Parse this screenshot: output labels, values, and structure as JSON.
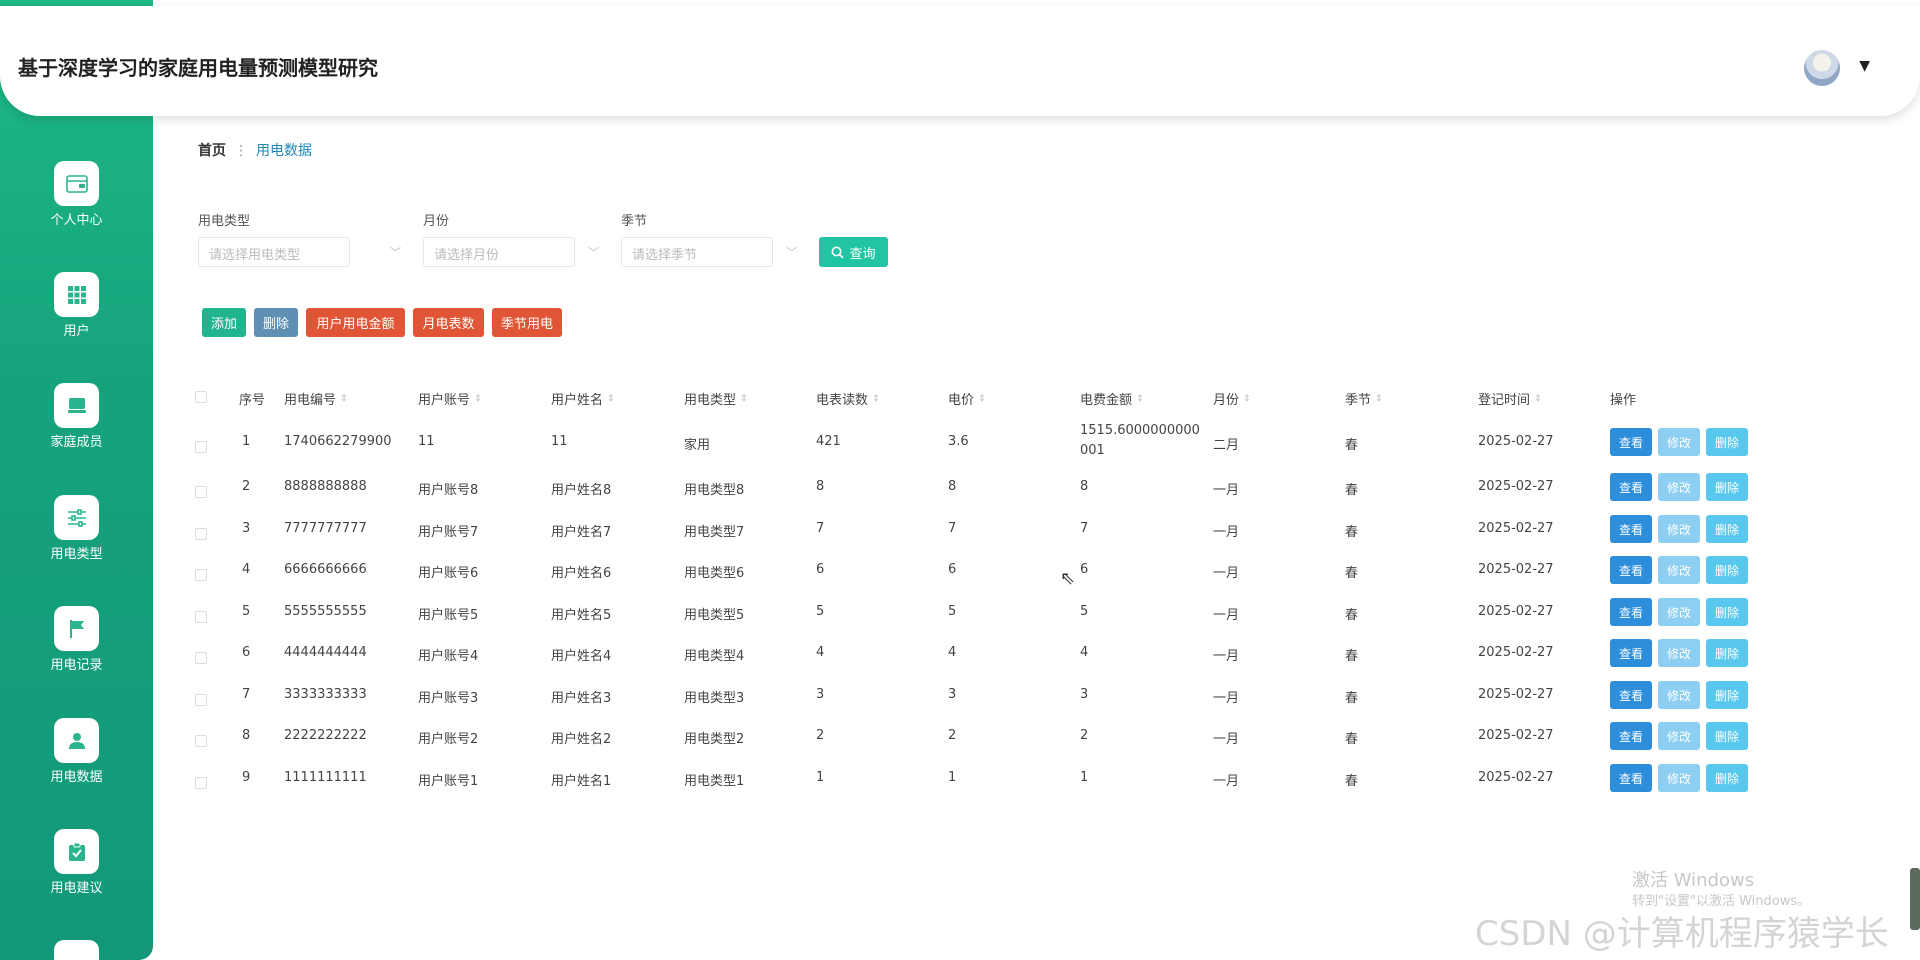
{
  "app": {
    "title": "基于深度学习的家庭用电量预测模型研究"
  },
  "colors": {
    "sidebar": "#16a37c",
    "accent": "#21c4a3",
    "view": "#2d8fdc",
    "edit": "#8ccff2",
    "delete": "#58c8ef",
    "orange_red": "#e05536",
    "slate": "#5f8fb3"
  },
  "sidebar": {
    "items": [
      {
        "label": "个人中心",
        "icon": "wallet-icon"
      },
      {
        "label": "用户",
        "icon": "grid-icon"
      },
      {
        "label": "家庭成员",
        "icon": "monitor-icon"
      },
      {
        "label": "用电类型",
        "icon": "sliders-icon"
      },
      {
        "label": "用电记录",
        "icon": "flag-icon"
      },
      {
        "label": "用电数据",
        "icon": "user-icon"
      },
      {
        "label": "用电建议",
        "icon": "clipboard-check-icon"
      }
    ]
  },
  "breadcrumb": {
    "home": "首页",
    "current": "用电数据"
  },
  "filters": {
    "type": {
      "label": "用电类型",
      "placeholder": "请选择用电类型"
    },
    "month": {
      "label": "月份",
      "placeholder": "请选择月份"
    },
    "season": {
      "label": "季节",
      "placeholder": "请选择季节"
    },
    "query_label": "查询"
  },
  "actions": {
    "add": "添加",
    "delete": "删除",
    "user_amount": "用户用电金额",
    "monthly_reading": "月电表数",
    "season_usage": "季节用电"
  },
  "table": {
    "headers": [
      "序号",
      "用电编号",
      "用户账号",
      "用户姓名",
      "用电类型",
      "电表读数",
      "电价",
      "电费金额",
      "月份",
      "季节",
      "登记时间",
      "操作"
    ],
    "row_buttons": {
      "view": "查看",
      "edit": "修改",
      "delete": "删除"
    },
    "rows": [
      [
        "1",
        "1740662279900",
        "11",
        "11",
        "家用",
        "421",
        "3.6",
        "1515.6000000000001",
        "二月",
        "春",
        "2025-02-27"
      ],
      [
        "2",
        "8888888888",
        "用户账号8",
        "用户姓名8",
        "用电类型8",
        "8",
        "8",
        "8",
        "一月",
        "春",
        "2025-02-27"
      ],
      [
        "3",
        "7777777777",
        "用户账号7",
        "用户姓名7",
        "用电类型7",
        "7",
        "7",
        "7",
        "一月",
        "春",
        "2025-02-27"
      ],
      [
        "4",
        "6666666666",
        "用户账号6",
        "用户姓名6",
        "用电类型6",
        "6",
        "6",
        "6",
        "一月",
        "春",
        "2025-02-27"
      ],
      [
        "5",
        "5555555555",
        "用户账号5",
        "用户姓名5",
        "用电类型5",
        "5",
        "5",
        "5",
        "一月",
        "春",
        "2025-02-27"
      ],
      [
        "6",
        "4444444444",
        "用户账号4",
        "用户姓名4",
        "用电类型4",
        "4",
        "4",
        "4",
        "一月",
        "春",
        "2025-02-27"
      ],
      [
        "7",
        "3333333333",
        "用户账号3",
        "用户姓名3",
        "用电类型3",
        "3",
        "3",
        "3",
        "一月",
        "春",
        "2025-02-27"
      ],
      [
        "8",
        "2222222222",
        "用户账号2",
        "用户姓名2",
        "用电类型2",
        "2",
        "2",
        "2",
        "一月",
        "春",
        "2025-02-27"
      ],
      [
        "9",
        "1111111111",
        "用户账号1",
        "用户姓名1",
        "用电类型1",
        "1",
        "1",
        "1",
        "一月",
        "春",
        "2025-02-27"
      ]
    ]
  },
  "watermark": {
    "activate": "激活 Windows",
    "activate_hint": "转到\"设置\"以激活 Windows。",
    "csdn": "CSDN @计算机程序猿学长"
  }
}
